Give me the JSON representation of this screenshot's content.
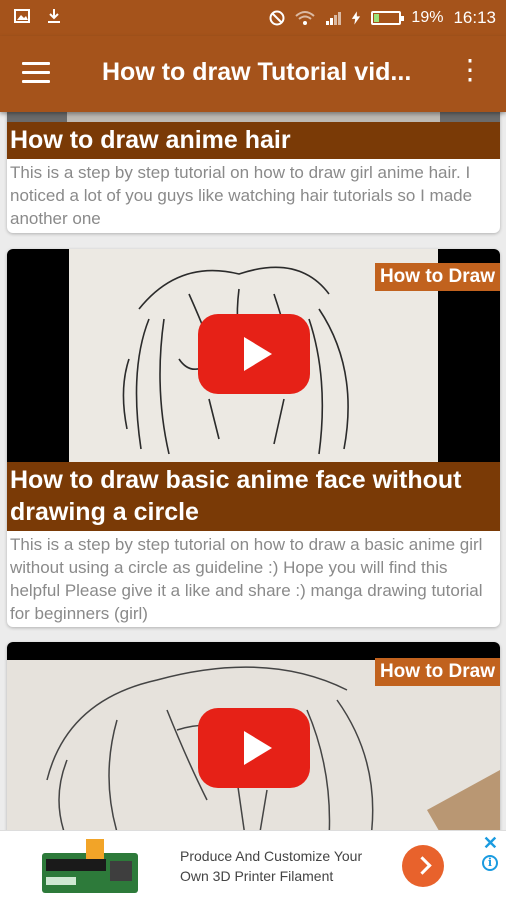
{
  "status_bar": {
    "battery_percent": "19%",
    "battery_level": 0.19,
    "time": "16:13",
    "left_icons": [
      "image-icon",
      "download-icon"
    ],
    "right_icons": [
      "do-not-disturb-icon",
      "wifi-icon",
      "signal-icon",
      "charging-icon",
      "battery-icon"
    ]
  },
  "app_bar": {
    "title": "How to draw Tutorial vid...",
    "menu_icon": "hamburger-menu-icon",
    "more_icon": "more-vert-icon",
    "more_glyph": "⋮"
  },
  "videos": [
    {
      "title": "How to draw anime hair",
      "description": "This is a step by step tutorial on how to draw girl anime hair. I noticed a lot of you guys like watching hair tutorials so I made another one"
    },
    {
      "badge": "How to Draw",
      "title": "How to draw basic anime face without drawing a circle",
      "description": "This is a step by step tutorial on how to draw a basic anime girl without using a circle as guideline :) Hope you will find this helpful  Please give it a like and share :) manga drawing tutorial for beginners (girl)"
    },
    {
      "badge": "How to Draw"
    }
  ],
  "ad": {
    "text": "Produce And Customize Your Own 3D Printer Filament",
    "close_glyph": "✕",
    "info_glyph": "i",
    "accent": "#e8622c",
    "adchoices_color": "#1a9be0"
  },
  "colors": {
    "primary": "#a5531b",
    "title_band": "#7a3a06",
    "badge": "#c1621e",
    "play": "#e62117"
  }
}
